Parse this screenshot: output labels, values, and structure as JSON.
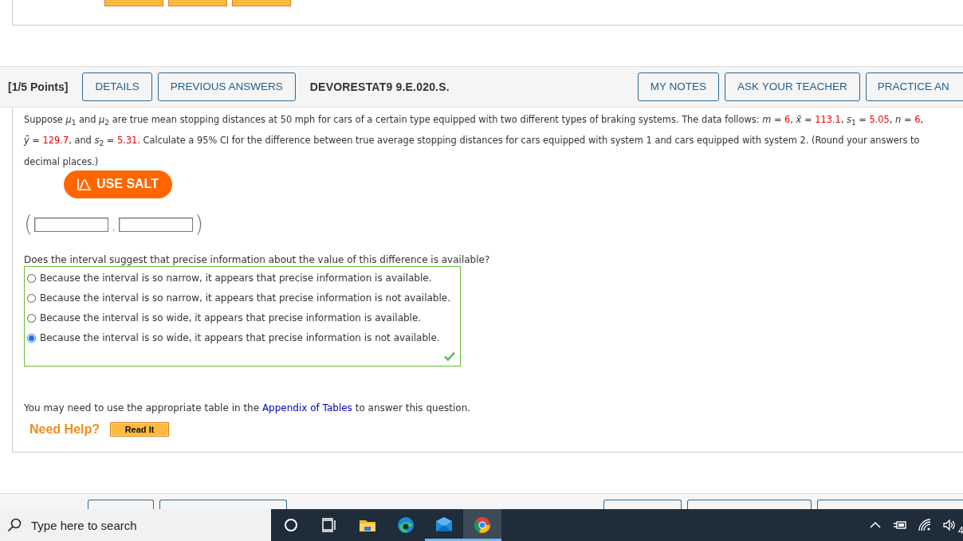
{
  "question_header": {
    "points": "[1/5 Points]",
    "buttons_left": [
      "DETAILS",
      "PREVIOUS ANSWERS"
    ],
    "code": "DEVORESTAT9 9.E.020.S.",
    "buttons_right": [
      "MY NOTES",
      "ASK YOUR TEACHER",
      "PRACTICE AN"
    ]
  },
  "question": {
    "segments": [
      {
        "kind": "text",
        "text": "Suppose *μ*$_{1}$ and *μ*$_{2}$ are true mean stopping distances at 50 mph for cars of a certain type equipped with two different types of braking systems. The data follows: *m* = "
      },
      {
        "kind": "value",
        "text": "6"
      },
      {
        "kind": "text",
        "text": ", *x̄* = "
      },
      {
        "kind": "value",
        "text": "113.1"
      },
      {
        "kind": "text",
        "text": ", *s*$_{1}$ = "
      },
      {
        "kind": "value",
        "text": "5.05"
      },
      {
        "kind": "text",
        "text": ", *n* = "
      },
      {
        "kind": "value",
        "text": "6"
      },
      {
        "kind": "text",
        "text": ","
      },
      {
        "kind": "break"
      },
      {
        "kind": "text",
        "text": "*ȳ* = "
      },
      {
        "kind": "value",
        "text": "129.7"
      },
      {
        "kind": "text",
        "text": ", and *s*$_{2}$ = "
      },
      {
        "kind": "value",
        "text": "5.31"
      },
      {
        "kind": "text",
        "text": ". Calculate a 95% CI for the difference between true average stopping distances for cars equipped with system 1 and cars equipped with system 2. (Round your answers to"
      },
      {
        "kind": "break"
      },
      {
        "kind": "text",
        "text": "decimal places.)"
      }
    ],
    "salt_button": "USE SALT",
    "interval": {
      "open": "(",
      "separator": ",",
      "close": ")",
      "fields": [
        {
          "kind": "blank"
        },
        {
          "kind": "blank"
        }
      ]
    },
    "prompt": "Does the interval suggest that precise information about the value of this difference is available?",
    "options": [
      {
        "label": "Because the interval is so narrow, it appears that precise information is available.",
        "selected": false
      },
      {
        "label": "Because the interval is so narrow, it appears that precise information is not available.",
        "selected": false
      },
      {
        "label": "Because the interval is so wide, it appears that precise information is available.",
        "selected": false
      },
      {
        "label": "Because the interval is so wide, it appears that precise information is not available.",
        "selected": true
      }
    ],
    "correct": true,
    "note": [
      {
        "kind": "text",
        "text": "You may need to use the appropriate table in the "
      },
      {
        "kind": "link",
        "text": "Appendix of Tables"
      },
      {
        "kind": "text",
        "text": " to answer this question."
      }
    ],
    "need_help": "Need Help?",
    "help_buttons": [
      "Read It"
    ]
  },
  "taskbar": {
    "search_placeholder": "Type here to search",
    "apps": [
      {
        "kind": "cortana",
        "running": false,
        "selected": false
      },
      {
        "kind": "taskview",
        "running": false,
        "selected": false
      },
      {
        "kind": "files",
        "running": false,
        "selected": false
      },
      {
        "kind": "edge",
        "running": false,
        "selected": false
      },
      {
        "kind": "mail",
        "running": true,
        "selected": false
      },
      {
        "kind": "chrome",
        "running": true,
        "selected": true
      }
    ],
    "tray": [
      {
        "kind": "chevron"
      },
      {
        "kind": "battery"
      },
      {
        "kind": "wifi"
      },
      {
        "kind": "volume"
      }
    ],
    "clock": "4"
  }
}
